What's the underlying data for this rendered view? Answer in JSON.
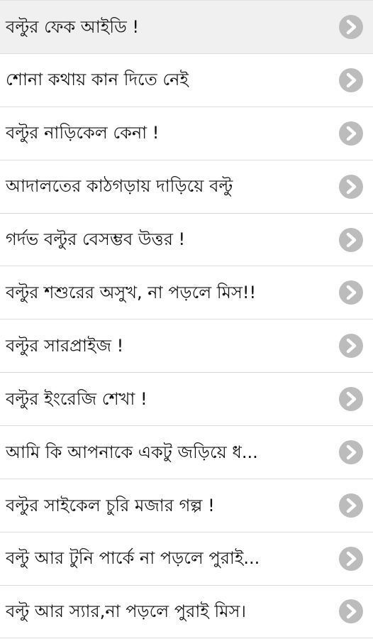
{
  "colors": {
    "chevron_bg": "#bcbcbc",
    "chevron_fg": "#ffffff",
    "row_selected_bg": "#f0f0f0",
    "divider": "#dcdcdc",
    "text": "#111111"
  },
  "icons": {
    "row_chevron": "chevron-right-icon"
  },
  "list": {
    "items": [
      {
        "label": "বল্টুর ফেক আইডি !"
      },
      {
        "label": "শোনা কথায় কান দিতে নেই"
      },
      {
        "label": "বল্টুর নাড়িকেল কেনা !"
      },
      {
        "label": "আদালতের কাঠগড়ায় দাড়িয়ে বল্টু"
      },
      {
        "label": "গর্দভ বল্টুর বেসম্ভব উত্তর !"
      },
      {
        "label": "বল্টুর শশুরের অসুখ, না পড়লে মিস!!"
      },
      {
        "label": "বল্টুর সারপ্রাইজ !"
      },
      {
        "label": "বল্টুর ইংরেজি শেখা !"
      },
      {
        "label": "আমি কি আপনাকে একটু জড়িয়ে ধ..."
      },
      {
        "label": "বল্টুর সাইকেল চুরি মজার গল্প !"
      },
      {
        "label": "বল্টু আর টুনি পার্কে না পড়লে পুরাই..."
      },
      {
        "label": "বল্টু আর স্যার,না পড়লে পুরাই মিস।"
      }
    ]
  }
}
